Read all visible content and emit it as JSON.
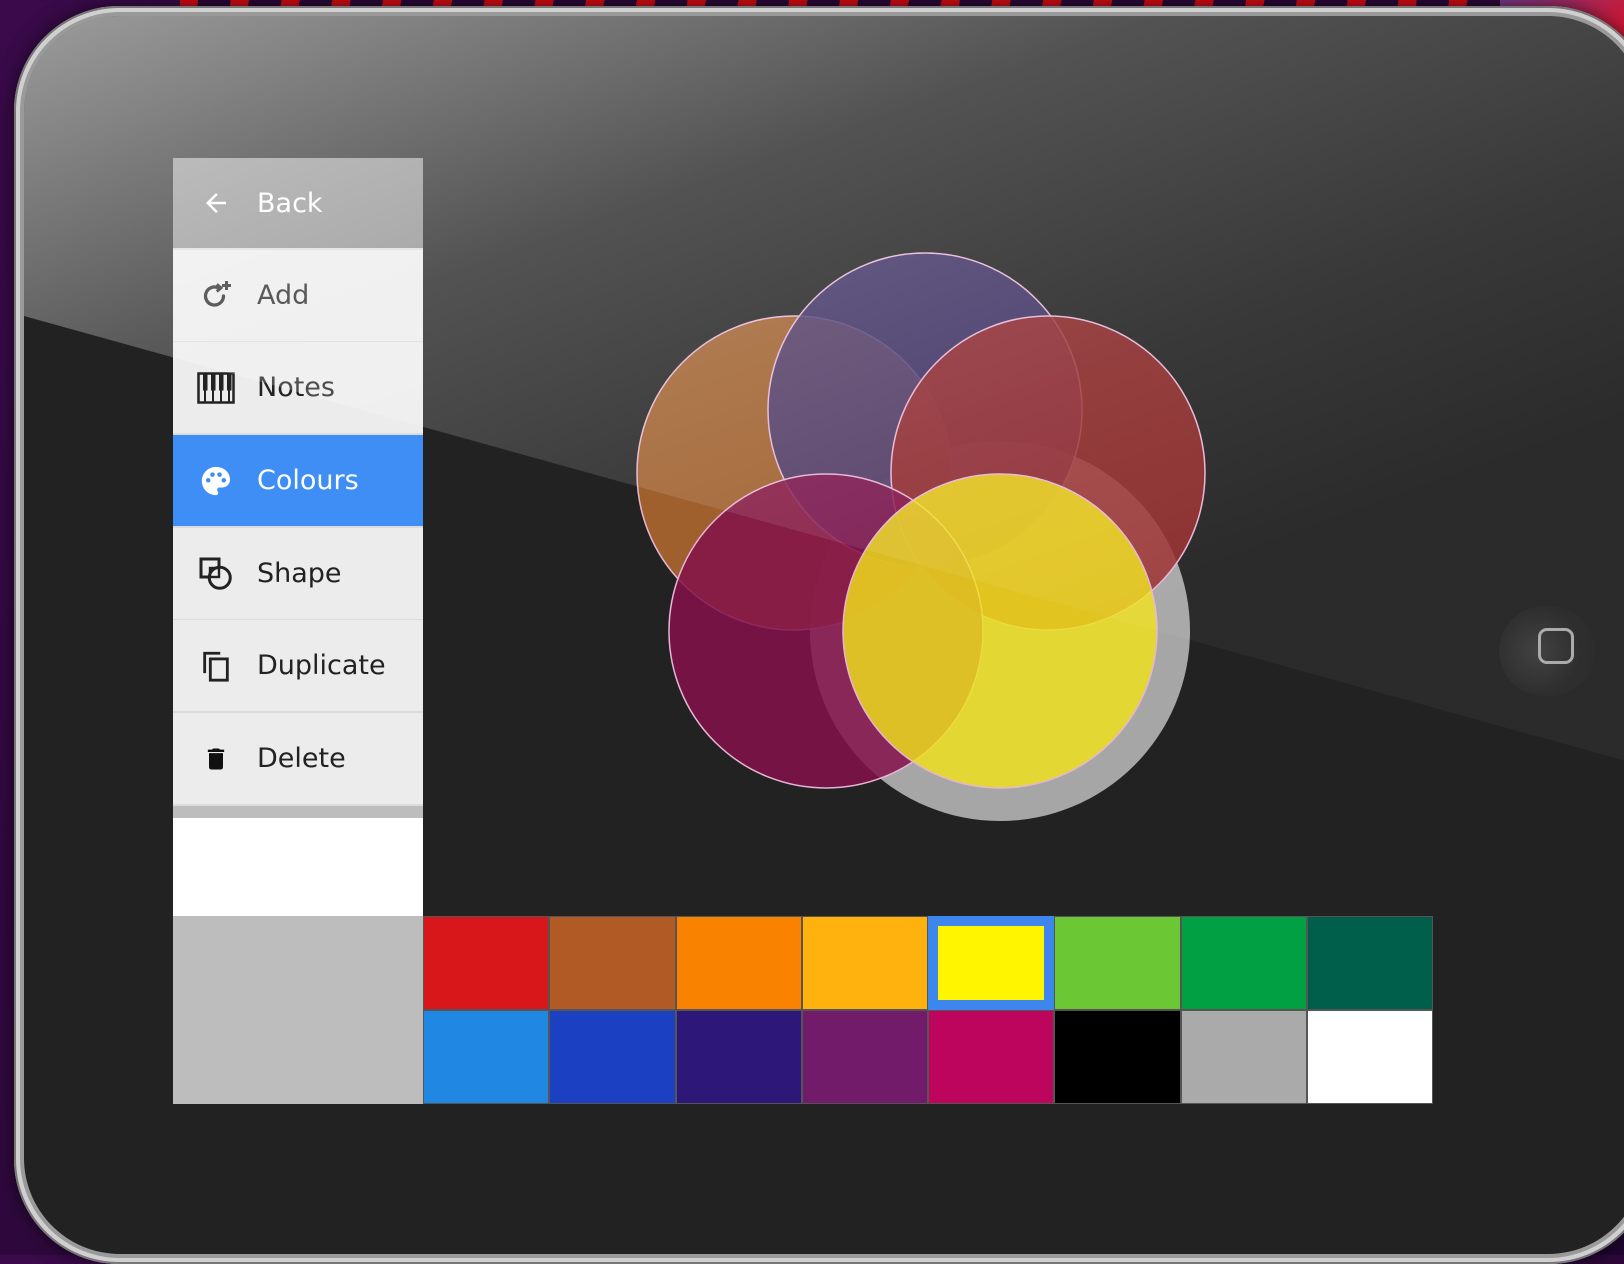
{
  "menu": {
    "back": {
      "label": "Back",
      "icon": "arrow-left-icon"
    },
    "items": [
      {
        "label": "Add",
        "icon": "add-rotate-icon"
      },
      {
        "label": "Notes",
        "icon": "piano-keys-icon"
      },
      {
        "label": "Colours",
        "icon": "palette-icon",
        "active": true
      },
      {
        "label": "Shape",
        "icon": "shape-icon"
      },
      {
        "label": "Duplicate",
        "icon": "duplicate-icon"
      },
      {
        "label": "Delete",
        "icon": "trash-icon"
      }
    ]
  },
  "palette": {
    "row1": [
      "#d7171a",
      "#b15a25",
      "#f98200",
      "#ffb20e",
      "#fff500",
      "#6bc734",
      "#00a043",
      "#005f4a"
    ],
    "row2": [
      "#2087e3",
      "#1b40c2",
      "#2d1779",
      "#721b6b",
      "#bd055e",
      "#000000",
      "#aaaaaa",
      "#ffffff"
    ],
    "selected_color": "#fff500"
  },
  "canvas": {
    "circles": [
      {
        "color": "#b1692f"
      },
      {
        "color": "#443670"
      },
      {
        "color": "#9a2a2a"
      },
      {
        "color": "#83104a"
      },
      {
        "color": "#f0e21a",
        "selected": true
      }
    ]
  }
}
